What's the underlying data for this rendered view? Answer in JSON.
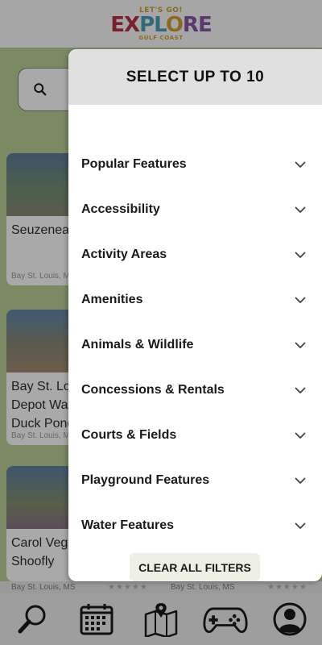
{
  "header": {
    "logo_top": "LET'S GO!",
    "logo_main": "EXPLORE",
    "logo_bottom": "GULF COAST"
  },
  "background_cards": [
    {
      "name": "Seuzeneau",
      "location": "Bay St. Louis, MS"
    },
    {
      "name": "Bay St. Louis Depot Walk Duck Pond",
      "location": "Bay St. Louis, MS"
    },
    {
      "name": "Carol Vega Shoofly",
      "location": "Bay St. Louis, MS"
    }
  ],
  "modal": {
    "title": "SELECT UP TO 10",
    "filters": [
      {
        "label": "Popular Features"
      },
      {
        "label": "Accessibility"
      },
      {
        "label": "Activity Areas"
      },
      {
        "label": "Amenities"
      },
      {
        "label": "Animals & Wildlife"
      },
      {
        "label": "Concessions & Rentals"
      },
      {
        "label": "Courts & Fields"
      },
      {
        "label": "Playground Features"
      },
      {
        "label": "Water Features"
      }
    ],
    "clear_label": "CLEAR ALL FILTERS"
  },
  "strip": {
    "loc_left": "Bay St. Louis, MS",
    "loc_right": "Bay St. Louis, MS",
    "stars": "★★★★★"
  },
  "bottom_nav": [
    {
      "icon": "search-icon"
    },
    {
      "icon": "calendar-icon"
    },
    {
      "icon": "map-icon"
    },
    {
      "icon": "gamepad-icon"
    },
    {
      "icon": "profile-icon"
    }
  ]
}
